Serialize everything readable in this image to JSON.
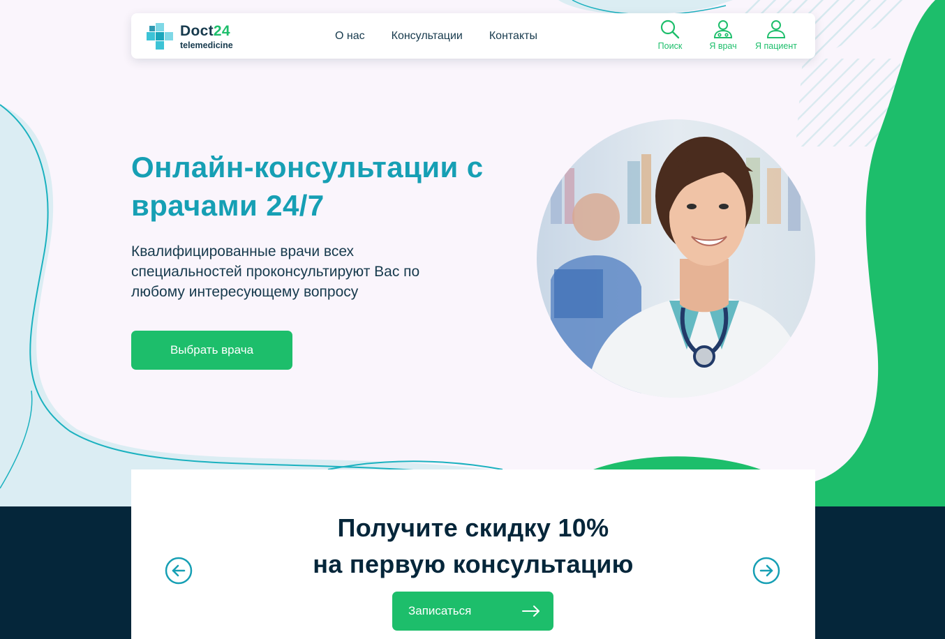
{
  "brand": {
    "name_main": "Doct",
    "name_accent": "24",
    "tagline": "telemedicine",
    "colors": {
      "green": "#1dbe6b",
      "teal": "#169fb4",
      "navy": "#05263a",
      "text": "#173a4d"
    }
  },
  "nav": {
    "items": [
      {
        "label": "О нас"
      },
      {
        "label": "Консультации"
      },
      {
        "label": "Контакты"
      }
    ]
  },
  "header_actions": {
    "search": {
      "label": "Поиск",
      "icon": "search-icon"
    },
    "doctor": {
      "label": "Я врач",
      "icon": "doctor-icon"
    },
    "patient": {
      "label": "Я пациент",
      "icon": "user-icon"
    }
  },
  "hero": {
    "title": "Онлайн-консультации с врачами 24/7",
    "text": "Квалифицированные врачи всех специальностей проконсультируют Вас по любому интересующему вопросу",
    "cta_label": "Выбрать врача",
    "image": "doctor-photo"
  },
  "promo": {
    "title_line1": "Получите скидку 10%",
    "title_line2": "на первую консультацию",
    "cta_label": "Записаться",
    "prev_icon": "arrow-left-circle-icon",
    "next_icon": "arrow-right-circle-icon"
  }
}
